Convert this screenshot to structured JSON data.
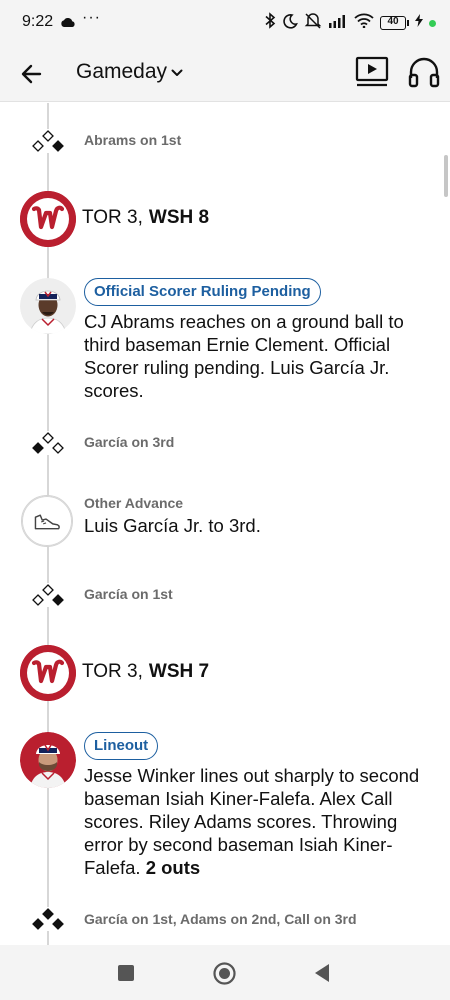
{
  "status_bar": {
    "time": "9:22",
    "dots": "···",
    "battery_level": "40",
    "icons": [
      "cloud-icon",
      "bluetooth-icon",
      "moon-icon",
      "mute-icon",
      "signal-icon",
      "wifi-icon",
      "battery-icon",
      "charging-icon"
    ]
  },
  "header": {
    "title": "Gameday",
    "icons": [
      "back-arrow-icon",
      "chevron-down-icon",
      "tv-icon",
      "headphones-icon"
    ]
  },
  "colors": {
    "nationals_red": "#ba1f2f",
    "tag_blue": "#1d5fa0",
    "muted_text": "#6b6b6b",
    "timeline": "#d7d7d7"
  },
  "feed": {
    "runners_1": {
      "text": "Abrams on 1st",
      "bases": {
        "first": true,
        "second": false,
        "third": false
      }
    },
    "score_1": {
      "away": "TOR 3,",
      "home": "WSH 8"
    },
    "play_1": {
      "tag": "Official Scorer Ruling Pending",
      "description": "CJ Abrams reaches on a ground ball to third baseman Ernie Clement. Official Scorer ruling pending. Luis García Jr. scores."
    },
    "runners_2": {
      "text": "García on 3rd",
      "bases": {
        "first": false,
        "second": false,
        "third": true
      }
    },
    "advance": {
      "label": "Other Advance",
      "description": "Luis García Jr. to 3rd."
    },
    "runners_3": {
      "text": "García on 1st",
      "bases": {
        "first": true,
        "second": false,
        "third": false
      }
    },
    "score_2": {
      "away": "TOR 3,",
      "home": "WSH 7"
    },
    "play_2": {
      "tag": "Lineout",
      "description": "Jesse Winker lines out sharply to second baseman Isiah Kiner-Falefa. Alex Call scores. Riley Adams scores. Throwing error by second baseman Isiah Kiner-Falefa.",
      "outs": "2 outs"
    },
    "runners_4": {
      "text": "García on 1st, Adams on 2nd, Call on 3rd",
      "bases": {
        "first": true,
        "second": true,
        "third": true
      }
    }
  },
  "nav_bar": {
    "icons": [
      "recents-square-icon",
      "home-circle-icon",
      "back-triangle-icon"
    ]
  }
}
